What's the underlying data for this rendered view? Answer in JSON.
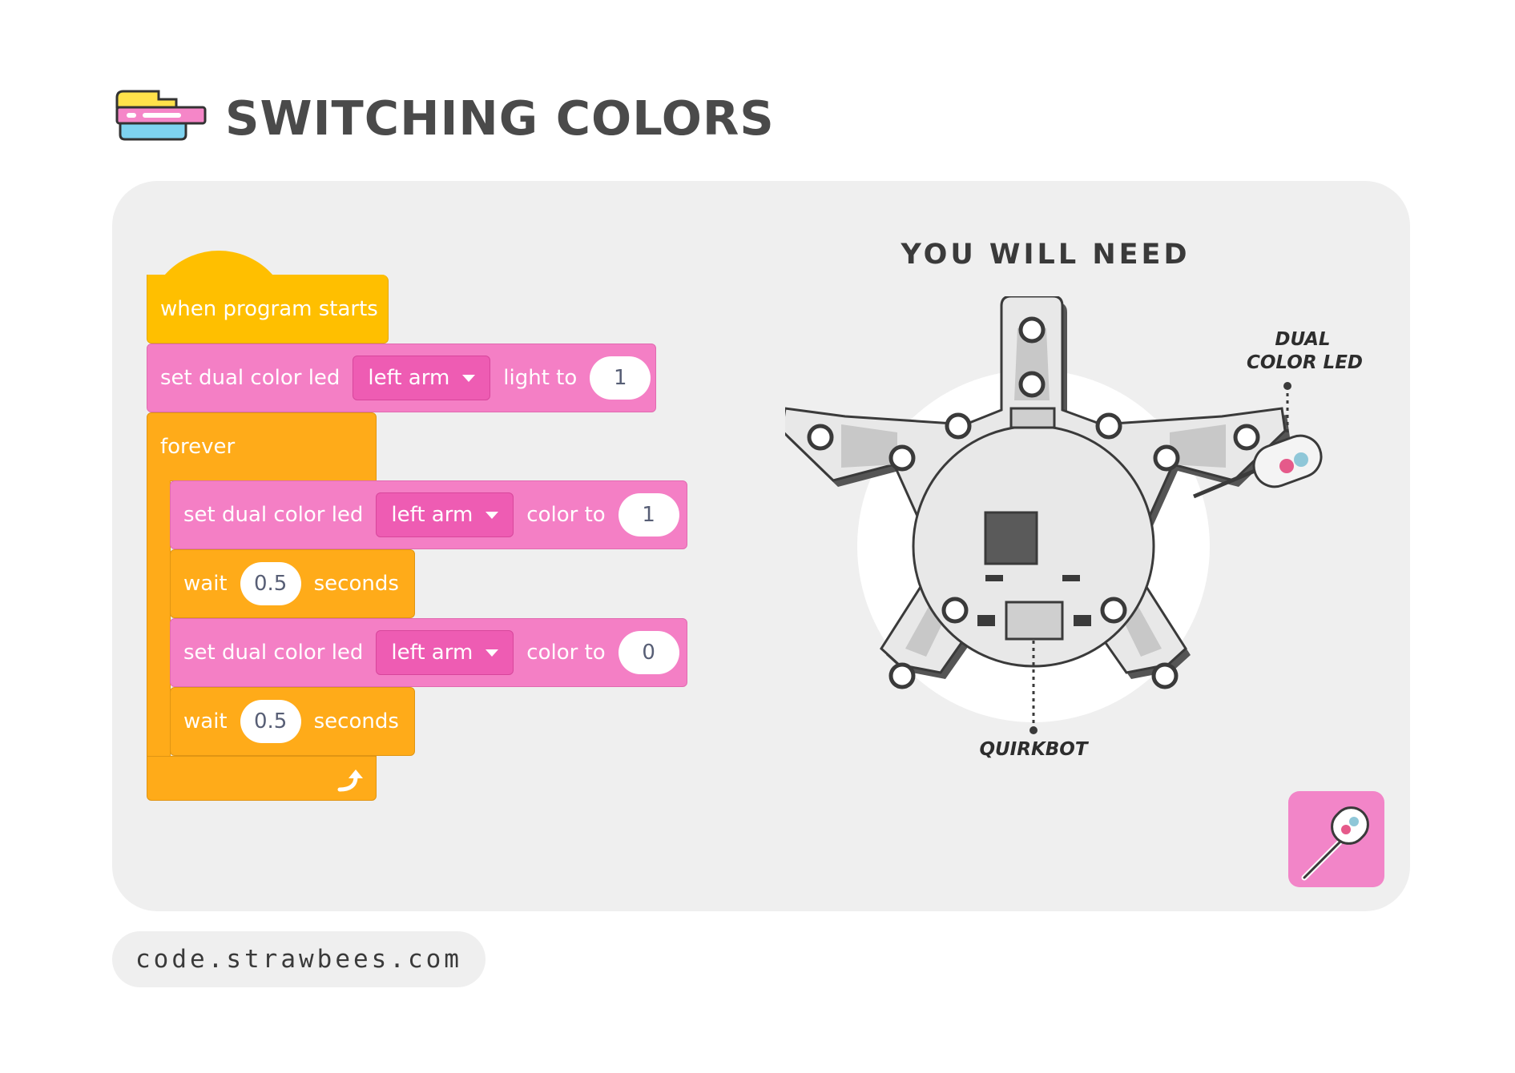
{
  "header": {
    "title": "SWITCHING COLORS"
  },
  "program": {
    "hat": "when program starts",
    "set_light": {
      "label": "set dual color led",
      "target": "left arm",
      "suffix": "light to",
      "value": "1"
    },
    "forever": "forever",
    "steps": [
      {
        "label": "set dual color led",
        "target": "left arm",
        "suffix": "color to",
        "value": "1"
      },
      {
        "label": "wait",
        "value": "0.5",
        "suffix": "seconds"
      },
      {
        "label": "set dual color led",
        "target": "left arm",
        "suffix": "color to",
        "value": "0"
      },
      {
        "label": "wait",
        "value": "0.5",
        "suffix": "seconds"
      }
    ]
  },
  "requirements": {
    "title": "YOU WILL NEED",
    "items": [
      {
        "line1": "DUAL",
        "line2": "COLOR LED",
        "icon": "led-icon"
      },
      {
        "name": "QUIRKBOT",
        "icon": "quirkbot-board-icon"
      }
    ]
  },
  "footer": {
    "url": "code.strawbees.com"
  },
  "colors": {
    "event": "#ffbf00",
    "control": "#ffab19",
    "output": "#f47fc5",
    "dropdown": "#ee5cb3",
    "badge": "#f285c8",
    "panel": "#efefef"
  }
}
